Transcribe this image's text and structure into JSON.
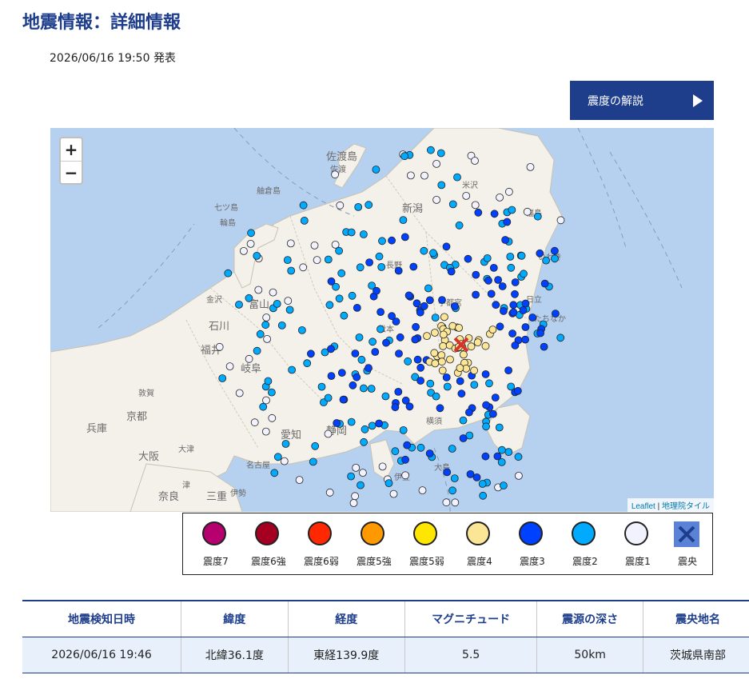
{
  "header": {
    "title": "地震情報：詳細情報",
    "published": "2026/06/16 19:50 発表",
    "explain_button": "震度の解説"
  },
  "map": {
    "zoom_in": "+",
    "zoom_out": "−",
    "attribution_leaflet": "Leaflet",
    "attribution_sep": " | ",
    "attribution_tiles": "地理院タイル",
    "place_labels": [
      "佐渡島",
      "佐渡",
      "新潟",
      "輪島",
      "七ツ島",
      "舳倉島",
      "金沢",
      "富山",
      "石川",
      "福井",
      "岐阜",
      "愛知",
      "静岡",
      "京都",
      "兵庫",
      "大阪",
      "奈良",
      "三重",
      "伊勢",
      "伊豆",
      "大島",
      "横須",
      "日立",
      "いわき",
      "米沢",
      "福島",
      "宇都宮",
      "たちなか",
      "名古屋",
      "大津",
      "敦賀",
      "松本",
      "長野",
      "津"
    ]
  },
  "legend": {
    "items": [
      {
        "label": "震度7",
        "color": "#b5006e"
      },
      {
        "label": "震度6強",
        "color": "#a50021"
      },
      {
        "label": "震度6弱",
        "color": "#ff2800"
      },
      {
        "label": "震度5強",
        "color": "#ff9900"
      },
      {
        "label": "震度5弱",
        "color": "#ffe600"
      },
      {
        "label": "震度4",
        "color": "#fae696"
      },
      {
        "label": "震度3",
        "color": "#0041ff"
      },
      {
        "label": "震度2",
        "color": "#00aaff"
      },
      {
        "label": "震度1",
        "color": "#f2f2ff"
      }
    ],
    "epicenter_label": "震央"
  },
  "table": {
    "headers": [
      "地震検知日時",
      "緯度",
      "経度",
      "マグニチュード",
      "震源の深さ",
      "震央地名"
    ],
    "row": [
      "2026/06/16 19:46",
      "北緯36.1度",
      "東経139.9度",
      "5.5",
      "50km",
      "茨城県南部"
    ]
  },
  "colors": {
    "accent": "#1e3e8c",
    "sea": "#b6d0ef",
    "land": "#f4f1ea",
    "epicenter": "#d6332a"
  }
}
